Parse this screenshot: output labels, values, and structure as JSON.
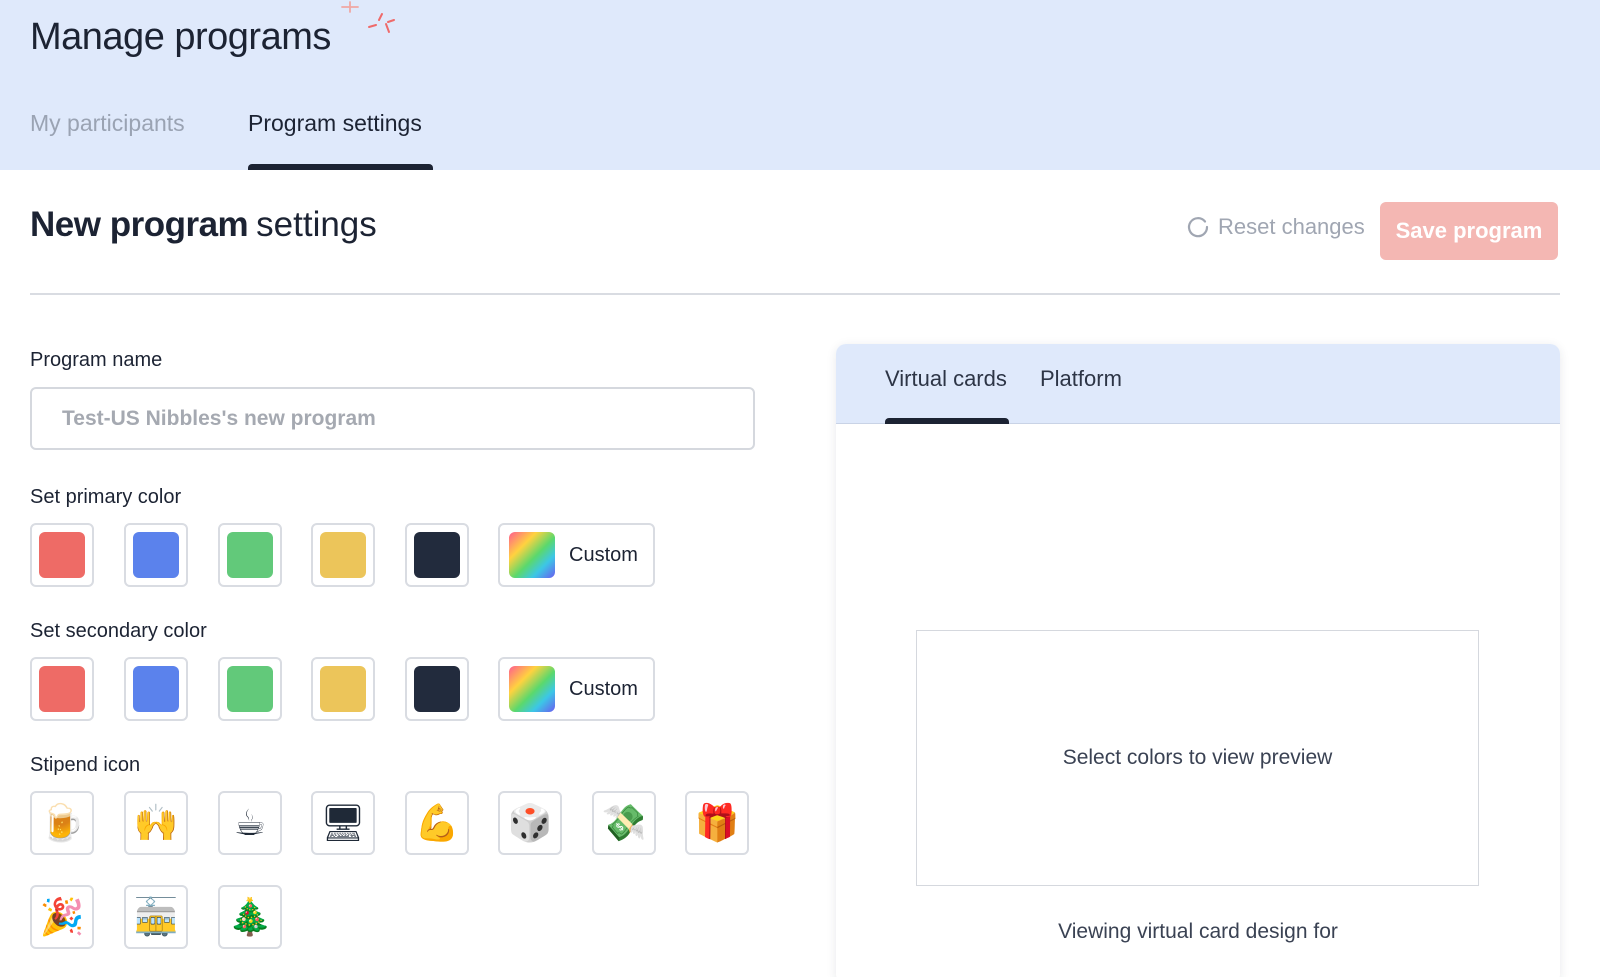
{
  "header": {
    "title": "Manage programs",
    "tabs": [
      {
        "label": "My participants",
        "active": false
      },
      {
        "label": "Program settings",
        "active": true
      }
    ]
  },
  "settings": {
    "title_bold": "New program",
    "title_light": "settings",
    "reset_label": "Reset changes",
    "save_label": "Save program"
  },
  "form": {
    "program_name_label": "Program name",
    "program_name_placeholder": "Test-US Nibbles's new program",
    "primary_color_label": "Set primary color",
    "secondary_color_label": "Set secondary color",
    "custom_label": "Custom",
    "colors": [
      "#ee6b66",
      "#5b82ec",
      "#62c97a",
      "#ecc55a",
      "#222b3d"
    ],
    "stipend_icon_label": "Stipend icon",
    "stipend_icons": [
      {
        "name": "beer-mug-icon",
        "glyph": "🍺"
      },
      {
        "name": "raising-hands-icon",
        "glyph": "🙌"
      },
      {
        "name": "hot-beverage-icon",
        "glyph": "☕"
      },
      {
        "name": "desktop-computer-icon",
        "glyph": "🖥"
      },
      {
        "name": "flexed-biceps-icon",
        "glyph": "💪"
      },
      {
        "name": "game-die-icon",
        "glyph": "🎲"
      },
      {
        "name": "money-with-wings-icon",
        "glyph": "💸"
      },
      {
        "name": "wrapped-gift-icon",
        "glyph": "🎁"
      },
      {
        "name": "party-popper-icon",
        "glyph": "🎉"
      },
      {
        "name": "tram-car-icon",
        "glyph": "🚋"
      },
      {
        "name": "christmas-tree-icon",
        "glyph": "🎄"
      }
    ]
  },
  "preview": {
    "tabs": [
      {
        "label": "Virtual cards",
        "active": true
      },
      {
        "label": "Platform",
        "active": false
      }
    ],
    "placeholder": "Select colors to view preview",
    "viewing_text": "Viewing virtual card design for"
  }
}
